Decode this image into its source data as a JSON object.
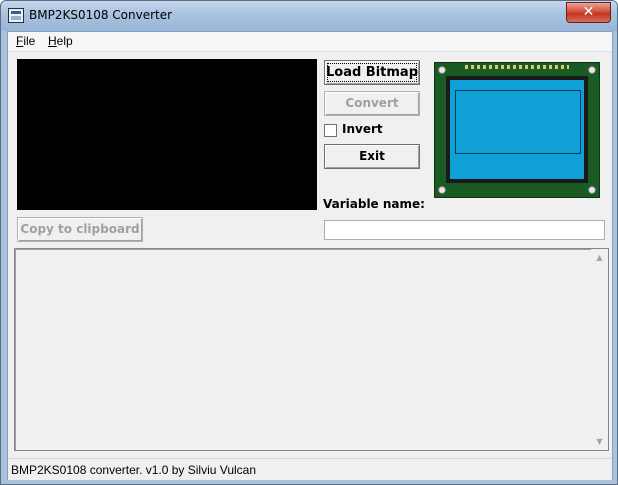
{
  "window": {
    "title": "BMP2KS0108 Converter",
    "close_glyph": "✕"
  },
  "menu": {
    "file": {
      "accel": "F",
      "rest": "ile"
    },
    "help": {
      "accel": "H",
      "rest": "elp"
    }
  },
  "buttons": {
    "load_bitmap": "Load Bitmap",
    "convert": "Convert",
    "exit": "Exit",
    "copy_clipboard": "Copy to clipboard"
  },
  "invert": {
    "label": "Invert",
    "checked": false
  },
  "variable": {
    "label": "Variable name:",
    "value": ""
  },
  "output": {
    "text": ""
  },
  "scroll": {
    "up_glyph": "▲",
    "down_glyph": "▼"
  },
  "status": {
    "text": "BMP2KS0108 converter. v1.0 by Silviu Vulcan"
  },
  "icons": {
    "app": "app-window-icon",
    "close": "close-icon",
    "lcd": "glcd-module-image"
  },
  "colors": {
    "lcd_board": "#1a5b24",
    "lcd_glass": "#0fa0d8",
    "preview_bg": "#000000"
  }
}
